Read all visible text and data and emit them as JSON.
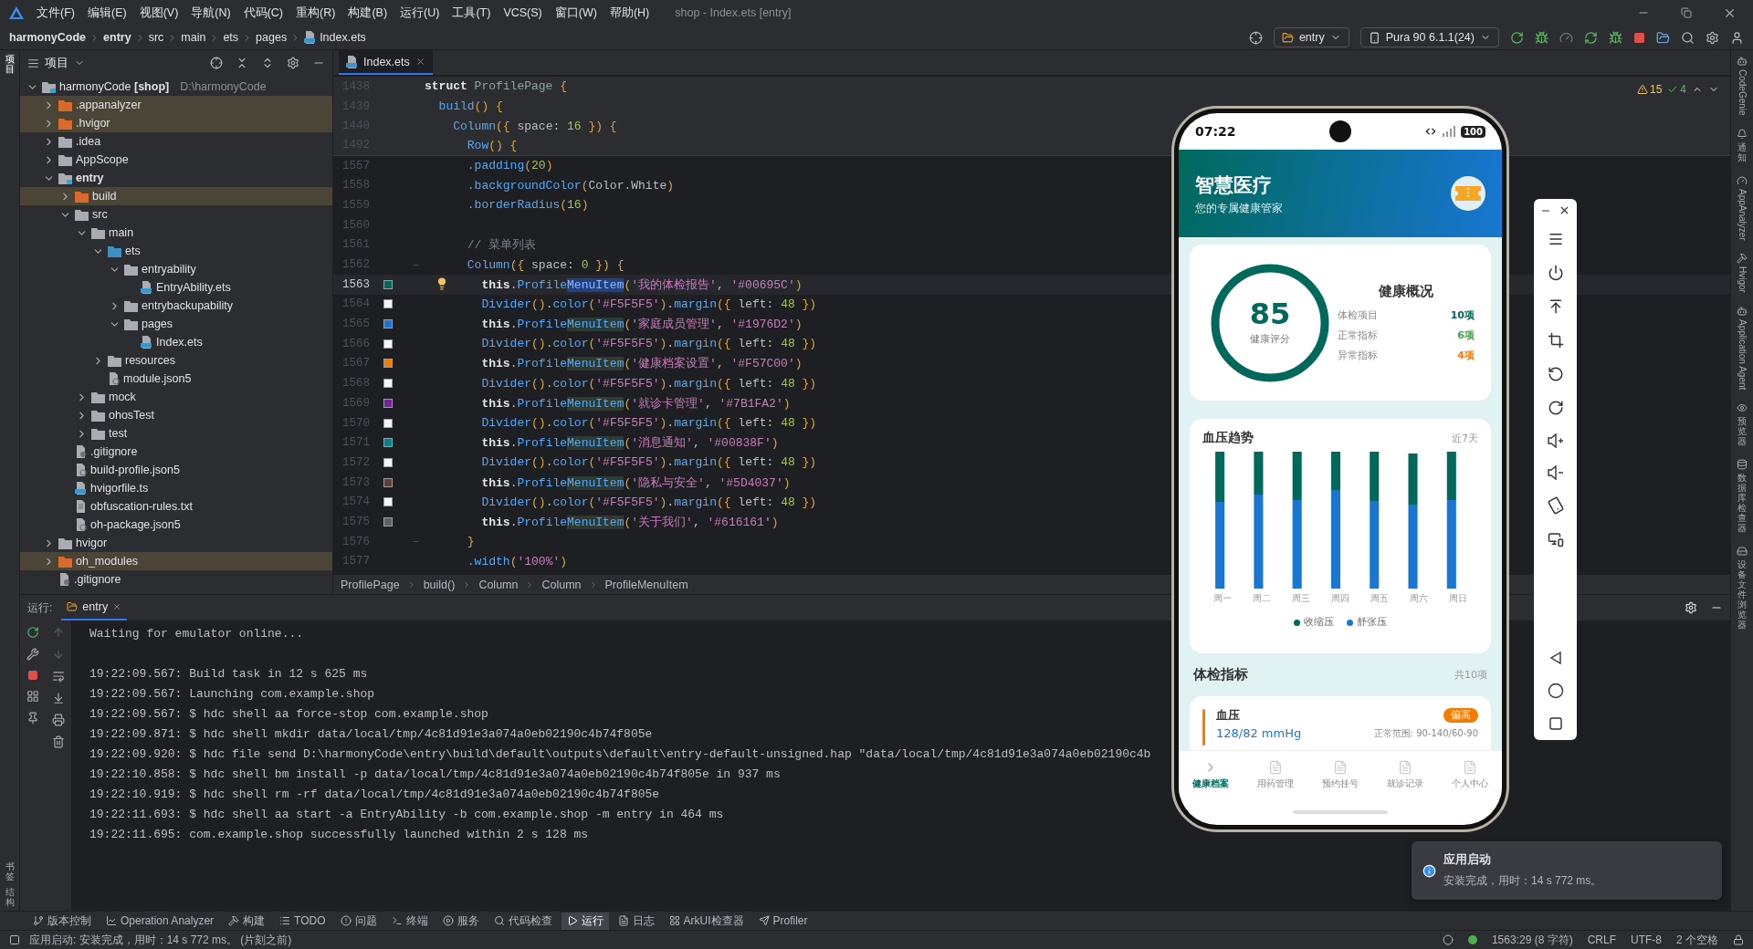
{
  "menu": [
    "文件(F)",
    "编辑(E)",
    "视图(V)",
    "导航(N)",
    "代码(C)",
    "重构(R)",
    "构建(B)",
    "运行(U)",
    "工具(T)",
    "VCS(S)",
    "窗口(W)",
    "帮助(H)"
  ],
  "window_title": "shop - Index.ets [entry]",
  "breadcrumb": [
    {
      "label": "harmonyCode",
      "bold": true,
      "kind": "dir"
    },
    {
      "label": "entry",
      "bold": true,
      "kind": "dir"
    },
    {
      "label": "src",
      "bold": false,
      "kind": "dir"
    },
    {
      "label": "main",
      "bold": false,
      "kind": "dir"
    },
    {
      "label": "ets",
      "bold": false,
      "kind": "dir"
    },
    {
      "label": "pages",
      "bold": false,
      "kind": "dir"
    },
    {
      "label": "Index.ets",
      "bold": false,
      "kind": "file"
    }
  ],
  "run_config": "entry",
  "device": "Pura 90 6.1.1(24)",
  "left_strip": {
    "top": [
      {
        "label": "项目",
        "selected": true
      }
    ],
    "bottom": [
      {
        "label": "书签",
        "selected": false
      },
      {
        "label": "结构",
        "selected": false
      }
    ]
  },
  "right_strip": [
    {
      "label": "CodeGenie",
      "kind": "rotated"
    },
    {
      "label": "通知",
      "kind": "stacked"
    },
    {
      "label": "AppAnalyzer",
      "kind": "rotated"
    },
    {
      "label": "Hvigor",
      "kind": "rotated"
    },
    {
      "label": "Application Agent",
      "kind": "rotated"
    },
    {
      "label": "预览器",
      "kind": "stacked"
    },
    {
      "label": "数据库检查器",
      "kind": "stacked"
    },
    {
      "label": "设备文件浏览器",
      "kind": "stacked"
    }
  ],
  "project": {
    "title": "项目",
    "tree": [
      {
        "label": "harmonyCode **[shop]**",
        "path": "D:\\harmonyCode",
        "kind": "module",
        "expanded": true,
        "children": [
          {
            "label": ".appanalyzer",
            "kind": "excluded",
            "expanded": false
          },
          {
            "label": ".hvigor",
            "kind": "excluded",
            "expanded": false
          },
          {
            "label": ".idea",
            "kind": "folder",
            "expanded": false
          },
          {
            "label": "AppScope",
            "kind": "folder",
            "expanded": false
          },
          {
            "label": "entry",
            "kind": "module",
            "bold": true,
            "expanded": true,
            "children": [
              {
                "label": "build",
                "kind": "excluded",
                "expanded": false
              },
              {
                "label": "src",
                "kind": "folder",
                "expanded": true,
                "children": [
                  {
                    "label": "main",
                    "kind": "folder",
                    "expanded": true,
                    "children": [
                      {
                        "label": "ets",
                        "kind": "source",
                        "expanded": true,
                        "children": [
                          {
                            "label": "entryability",
                            "kind": "folder",
                            "expanded": true,
                            "children": [
                              {
                                "label": "EntryAbility.ets",
                                "kind": "ets"
                              }
                            ]
                          },
                          {
                            "label": "entrybackupability",
                            "kind": "folder",
                            "expanded": false
                          },
                          {
                            "label": "pages",
                            "kind": "folder",
                            "expanded": true,
                            "children": [
                              {
                                "label": "Index.ets",
                                "kind": "ets"
                              }
                            ]
                          }
                        ]
                      },
                      {
                        "label": "resources",
                        "kind": "folder",
                        "expanded": false
                      },
                      {
                        "label": "module.json5",
                        "kind": "json"
                      }
                    ]
                  },
                  {
                    "label": "mock",
                    "kind": "folder",
                    "expanded": false
                  },
                  {
                    "label": "ohosTest",
                    "kind": "folder",
                    "expanded": false
                  },
                  {
                    "label": "test",
                    "kind": "folder",
                    "expanded": false
                  }
                ]
              },
              {
                "label": ".gitignore",
                "kind": "ignore"
              },
              {
                "label": "build-profile.json5",
                "kind": "json"
              },
              {
                "label": "hvigorfile.ts",
                "kind": "ts"
              },
              {
                "label": "obfuscation-rules.txt",
                "kind": "txt"
              },
              {
                "label": "oh-package.json5",
                "kind": "json"
              }
            ]
          },
          {
            "label": "hvigor",
            "kind": "folder",
            "expanded": false
          },
          {
            "label": "oh_modules",
            "kind": "excluded",
            "expanded": false
          },
          {
            "label": ".gitignore",
            "kind": "ignore"
          }
        ]
      }
    ]
  },
  "editor": {
    "tab": "Index.ets",
    "warnings": "15",
    "passed": "4",
    "lines": [
      {
        "number": "1438",
        "sticky": true,
        "segments": [
          {
            "kind": "kw",
            "text": "struct "
          },
          {
            "kind": "ty",
            "text": "ProfilePage "
          },
          {
            "kind": "br",
            "text": "{"
          }
        ]
      },
      {
        "number": "1439",
        "sticky": true,
        "segments": [
          {
            "kind": "me",
            "text": "  build"
          },
          {
            "kind": "br",
            "text": "() {"
          }
        ]
      },
      {
        "number": "1440",
        "sticky": true,
        "segments": [
          {
            "kind": "me",
            "text": "    Column"
          },
          {
            "kind": "br",
            "text": "({"
          },
          {
            "kind": "pl",
            "text": " space: "
          },
          {
            "kind": "num",
            "text": "16"
          },
          {
            "kind": "br",
            "text": " }) {"
          }
        ]
      },
      {
        "number": "1492",
        "sticky": true,
        "segments": [
          {
            "kind": "me",
            "text": "      Row"
          },
          {
            "kind": "br",
            "text": "() {"
          }
        ]
      },
      {
        "number": "1557",
        "segments": [
          {
            "kind": "me",
            "text": "      .padding"
          },
          {
            "kind": "br",
            "text": "("
          },
          {
            "kind": "num",
            "text": "20"
          },
          {
            "kind": "br",
            "text": ")"
          }
        ]
      },
      {
        "number": "1558",
        "segments": [
          {
            "kind": "me",
            "text": "      .backgroundColor"
          },
          {
            "kind": "br",
            "text": "("
          },
          {
            "kind": "pl",
            "text": "Color.White"
          },
          {
            "kind": "br",
            "text": ")"
          }
        ]
      },
      {
        "number": "1559",
        "segments": [
          {
            "kind": "me",
            "text": "      .borderRadius"
          },
          {
            "kind": "br",
            "text": "("
          },
          {
            "kind": "num",
            "text": "16"
          },
          {
            "kind": "br",
            "text": ")"
          }
        ]
      },
      {
        "number": "1560"
      },
      {
        "number": "1561",
        "segments": [
          {
            "kind": "cm",
            "text": "      // 菜单列表"
          }
        ]
      },
      {
        "number": "1562",
        "fold": true,
        "segments": [
          {
            "kind": "me",
            "text": "      Column"
          },
          {
            "kind": "br",
            "text": "({"
          },
          {
            "kind": "pl",
            "text": " space: "
          },
          {
            "kind": "num",
            "text": "0"
          },
          {
            "kind": "br",
            "text": " }) {"
          }
        ]
      },
      {
        "number": "1563",
        "current": true,
        "bulb": true,
        "color": "#00695C",
        "segments": [
          {
            "kind": "kw",
            "text": "        this"
          },
          {
            "kind": "pl",
            "text": "."
          },
          {
            "kind": "me",
            "text": "Profile"
          },
          {
            "kind": "sel",
            "text": "MenuItem"
          },
          {
            "kind": "br",
            "text": "("
          },
          {
            "kind": "str",
            "text": "'我的体检报告'"
          },
          {
            "kind": "pl",
            "text": ", "
          },
          {
            "kind": "str",
            "text": "'#00695C'"
          },
          {
            "kind": "br",
            "text": ")"
          }
        ]
      },
      {
        "number": "1564",
        "color": "#F5F5F5",
        "segments": [
          {
            "kind": "me",
            "text": "        Divider"
          },
          {
            "kind": "br",
            "text": "()"
          },
          {
            "kind": "pl",
            "text": "."
          },
          {
            "kind": "me",
            "text": "color"
          },
          {
            "kind": "br",
            "text": "("
          },
          {
            "kind": "str",
            "text": "'#F5F5F5'"
          },
          {
            "kind": "br",
            "text": ")"
          },
          {
            "kind": "pl",
            "text": "."
          },
          {
            "kind": "me",
            "text": "margin"
          },
          {
            "kind": "br",
            "text": "({"
          },
          {
            "kind": "pl",
            "text": " left: "
          },
          {
            "kind": "num",
            "text": "48"
          },
          {
            "kind": "br",
            "text": " })"
          }
        ]
      },
      {
        "number": "1565",
        "color": "#1976D2",
        "segments": [
          {
            "kind": "kw",
            "text": "        this"
          },
          {
            "kind": "pl",
            "text": "."
          },
          {
            "kind": "me",
            "text": "Profile"
          },
          {
            "kind": "hl",
            "text": "MenuItem"
          },
          {
            "kind": "br",
            "text": "("
          },
          {
            "kind": "str",
            "text": "'家庭成员管理'"
          },
          {
            "kind": "pl",
            "text": ", "
          },
          {
            "kind": "str",
            "text": "'#1976D2'"
          },
          {
            "kind": "br",
            "text": ")"
          }
        ]
      },
      {
        "number": "1566",
        "color": "#F5F5F5",
        "segments": [
          {
            "kind": "me",
            "text": "        Divider"
          },
          {
            "kind": "br",
            "text": "()"
          },
          {
            "kind": "pl",
            "text": "."
          },
          {
            "kind": "me",
            "text": "color"
          },
          {
            "kind": "br",
            "text": "("
          },
          {
            "kind": "str",
            "text": "'#F5F5F5'"
          },
          {
            "kind": "br",
            "text": ")"
          },
          {
            "kind": "pl",
            "text": "."
          },
          {
            "kind": "me",
            "text": "margin"
          },
          {
            "kind": "br",
            "text": "({"
          },
          {
            "kind": "pl",
            "text": " left: "
          },
          {
            "kind": "num",
            "text": "48"
          },
          {
            "kind": "br",
            "text": " })"
          }
        ]
      },
      {
        "number": "1567",
        "color": "#F57C00",
        "segments": [
          {
            "kind": "kw",
            "text": "        this"
          },
          {
            "kind": "pl",
            "text": "."
          },
          {
            "kind": "me",
            "text": "Profile"
          },
          {
            "kind": "hl",
            "text": "MenuItem"
          },
          {
            "kind": "br",
            "text": "("
          },
          {
            "kind": "str",
            "text": "'健康档案设置'"
          },
          {
            "kind": "pl",
            "text": ", "
          },
          {
            "kind": "str",
            "text": "'#F57C00'"
          },
          {
            "kind": "br",
            "text": ")"
          }
        ]
      },
      {
        "number": "1568",
        "color": "#F5F5F5",
        "segments": [
          {
            "kind": "me",
            "text": "        Divider"
          },
          {
            "kind": "br",
            "text": "()"
          },
          {
            "kind": "pl",
            "text": "."
          },
          {
            "kind": "me",
            "text": "color"
          },
          {
            "kind": "br",
            "text": "("
          },
          {
            "kind": "str",
            "text": "'#F5F5F5'"
          },
          {
            "kind": "br",
            "text": ")"
          },
          {
            "kind": "pl",
            "text": "."
          },
          {
            "kind": "me",
            "text": "margin"
          },
          {
            "kind": "br",
            "text": "({"
          },
          {
            "kind": "pl",
            "text": " left: "
          },
          {
            "kind": "num",
            "text": "48"
          },
          {
            "kind": "br",
            "text": " })"
          }
        ]
      },
      {
        "number": "1569",
        "color": "#7B1FA2",
        "segments": [
          {
            "kind": "kw",
            "text": "        this"
          },
          {
            "kind": "pl",
            "text": "."
          },
          {
            "kind": "me",
            "text": "Profile"
          },
          {
            "kind": "hl",
            "text": "MenuItem"
          },
          {
            "kind": "br",
            "text": "("
          },
          {
            "kind": "str",
            "text": "'就诊卡管理'"
          },
          {
            "kind": "pl",
            "text": ", "
          },
          {
            "kind": "str",
            "text": "'#7B1FA2'"
          },
          {
            "kind": "br",
            "text": ")"
          }
        ]
      },
      {
        "number": "1570",
        "color": "#F5F5F5",
        "segments": [
          {
            "kind": "me",
            "text": "        Divider"
          },
          {
            "kind": "br",
            "text": "()"
          },
          {
            "kind": "pl",
            "text": "."
          },
          {
            "kind": "me",
            "text": "color"
          },
          {
            "kind": "br",
            "text": "("
          },
          {
            "kind": "str",
            "text": "'#F5F5F5'"
          },
          {
            "kind": "br",
            "text": ")"
          },
          {
            "kind": "pl",
            "text": "."
          },
          {
            "kind": "me",
            "text": "margin"
          },
          {
            "kind": "br",
            "text": "({"
          },
          {
            "kind": "pl",
            "text": " left: "
          },
          {
            "kind": "num",
            "text": "48"
          },
          {
            "kind": "br",
            "text": " })"
          }
        ]
      },
      {
        "number": "1571",
        "color": "#00838F",
        "segments": [
          {
            "kind": "kw",
            "text": "        this"
          },
          {
            "kind": "pl",
            "text": "."
          },
          {
            "kind": "me",
            "text": "Profile"
          },
          {
            "kind": "hl",
            "text": "MenuItem"
          },
          {
            "kind": "br",
            "text": "("
          },
          {
            "kind": "str",
            "text": "'消息通知'"
          },
          {
            "kind": "pl",
            "text": ", "
          },
          {
            "kind": "str",
            "text": "'#00838F'"
          },
          {
            "kind": "br",
            "text": ")"
          }
        ]
      },
      {
        "number": "1572",
        "color": "#F5F5F5",
        "segments": [
          {
            "kind": "me",
            "text": "        Divider"
          },
          {
            "kind": "br",
            "text": "()"
          },
          {
            "kind": "pl",
            "text": "."
          },
          {
            "kind": "me",
            "text": "color"
          },
          {
            "kind": "br",
            "text": "("
          },
          {
            "kind": "str",
            "text": "'#F5F5F5'"
          },
          {
            "kind": "br",
            "text": ")"
          },
          {
            "kind": "pl",
            "text": "."
          },
          {
            "kind": "me",
            "text": "margin"
          },
          {
            "kind": "br",
            "text": "({"
          },
          {
            "kind": "pl",
            "text": " left: "
          },
          {
            "kind": "num",
            "text": "48"
          },
          {
            "kind": "br",
            "text": " })"
          }
        ]
      },
      {
        "number": "1573",
        "color": "#5D4037",
        "segments": [
          {
            "kind": "kw",
            "text": "        this"
          },
          {
            "kind": "pl",
            "text": "."
          },
          {
            "kind": "me",
            "text": "Profile"
          },
          {
            "kind": "hl",
            "text": "MenuItem"
          },
          {
            "kind": "br",
            "text": "("
          },
          {
            "kind": "str",
            "text": "'隐私与安全'"
          },
          {
            "kind": "pl",
            "text": ", "
          },
          {
            "kind": "str",
            "text": "'#5D4037'"
          },
          {
            "kind": "br",
            "text": ")"
          }
        ]
      },
      {
        "number": "1574",
        "color": "#F5F5F5",
        "segments": [
          {
            "kind": "me",
            "text": "        Divider"
          },
          {
            "kind": "br",
            "text": "()"
          },
          {
            "kind": "pl",
            "text": "."
          },
          {
            "kind": "me",
            "text": "color"
          },
          {
            "kind": "br",
            "text": "("
          },
          {
            "kind": "str",
            "text": "'#F5F5F5'"
          },
          {
            "kind": "br",
            "text": ")"
          },
          {
            "kind": "pl",
            "text": "."
          },
          {
            "kind": "me",
            "text": "margin"
          },
          {
            "kind": "br",
            "text": "({"
          },
          {
            "kind": "pl",
            "text": " left: "
          },
          {
            "kind": "num",
            "text": "48"
          },
          {
            "kind": "br",
            "text": " })"
          }
        ]
      },
      {
        "number": "1575",
        "color": "#616161",
        "segments": [
          {
            "kind": "kw",
            "text": "        this"
          },
          {
            "kind": "pl",
            "text": "."
          },
          {
            "kind": "me",
            "text": "Profile"
          },
          {
            "kind": "hl",
            "text": "MenuItem"
          },
          {
            "kind": "br",
            "text": "("
          },
          {
            "kind": "str",
            "text": "'关于我们'"
          },
          {
            "kind": "pl",
            "text": ", "
          },
          {
            "kind": "str",
            "text": "'#616161'"
          },
          {
            "kind": "br",
            "text": ")"
          }
        ]
      },
      {
        "number": "1576",
        "fold": true,
        "segments": [
          {
            "kind": "br",
            "text": "      }"
          }
        ]
      },
      {
        "number": "1577",
        "segments": [
          {
            "kind": "me",
            "text": "      .width"
          },
          {
            "kind": "br",
            "text": "("
          },
          {
            "kind": "str",
            "text": "'100%'"
          },
          {
            "kind": "br",
            "text": ")"
          }
        ]
      }
    ],
    "path": [
      "ProfilePage",
      "build()",
      "Column",
      "Column",
      "ProfileMenuItem"
    ]
  },
  "run": {
    "title": "运行:",
    "tab": "entry",
    "status": "Waiting for emulator online...",
    "lines": [
      "19:22:09.567: Build task in 12 s 625 ms",
      "19:22:09.567: Launching com.example.shop",
      "19:22:09.567: $ hdc shell aa force-stop com.example.shop",
      "19:22:09.871: $ hdc shell mkdir data/local/tmp/4c81d91e3a074a0eb02190c4b74f805e",
      "19:22:09.920: $ hdc file send D:\\harmonyCode\\entry\\build\\default\\outputs\\default\\entry-default-unsigned.hap \"data/local/tmp/4c81d91e3a074a0eb02190c4b",
      "19:22:10.858: $ hdc shell bm install -p data/local/tmp/4c81d91e3a074a0eb02190c4b74f805e in 937 ms",
      "19:22:10.919: $ hdc shell rm -rf data/local/tmp/4c81d91e3a074a0eb02190c4b74f805e",
      "19:22:11.693: $ hdc shell aa start -a EntryAbility -b com.example.shop -m entry in 464 ms",
      "19:22:11.695: com.example.shop successfully launched within 2 s 128 ms"
    ]
  },
  "phone": {
    "time": "07:22",
    "battery": "100",
    "title": "智慧医疗",
    "subtitle": "您的专属健康管家",
    "score": "85",
    "score_label": "健康评分",
    "overview_title": "健康概况",
    "overview": [
      {
        "label": "体检项目",
        "value": "10项",
        "color": "#00695C"
      },
      {
        "label": "正常指标",
        "value": "6项",
        "color": "#43A047"
      },
      {
        "label": "异常指标",
        "value": "4项",
        "color": "#F57C00"
      }
    ],
    "chart_title": "血压趋势",
    "chart_range": "近7天",
    "days": [
      "周一",
      "周二",
      "周三",
      "周四",
      "周五",
      "周六",
      "周日"
    ],
    "legend": [
      {
        "label": "收缩压",
        "color": "#00695C"
      },
      {
        "label": "舒张压",
        "color": "#1976D2"
      }
    ],
    "section_title": "体检指标",
    "section_count": "共10项",
    "metric": {
      "name": "血压",
      "value": "128/82 mmHg",
      "badge": "偏高",
      "range": "正常范围: 90-140/60-90"
    },
    "tabs": [
      {
        "label": "健康档案",
        "selected": true
      },
      {
        "label": "用药管理",
        "selected": false
      },
      {
        "label": "预约挂号",
        "selected": false
      },
      {
        "label": "就诊记录",
        "selected": false
      },
      {
        "label": "个人中心",
        "selected": false
      }
    ]
  },
  "notification": {
    "title": "应用启动",
    "body": "安装完成，用时：14 s 772 ms。"
  },
  "tool_tabs": [
    {
      "label": "版本控制",
      "selected": false
    },
    {
      "label": "Operation Analyzer",
      "selected": false
    },
    {
      "label": "构建",
      "selected": false
    },
    {
      "label": "TODO",
      "selected": false
    },
    {
      "label": "问题",
      "selected": false
    },
    {
      "label": "终端",
      "selected": false
    },
    {
      "label": "服务",
      "selected": false
    },
    {
      "label": "代码检查",
      "selected": false
    },
    {
      "label": "运行",
      "selected": true
    },
    {
      "label": "日志",
      "selected": false
    },
    {
      "label": "ArkUI检查器",
      "selected": false
    },
    {
      "label": "Profiler",
      "selected": false
    }
  ],
  "status_bar": {
    "message": "应用启动: 安装完成，用时：14 s 772 ms。 (片刻之前)",
    "position": "1563:29 (8 字符)",
    "line_ending": "CRLF",
    "encoding": "UTF-8",
    "indent": "2 个空格"
  }
}
